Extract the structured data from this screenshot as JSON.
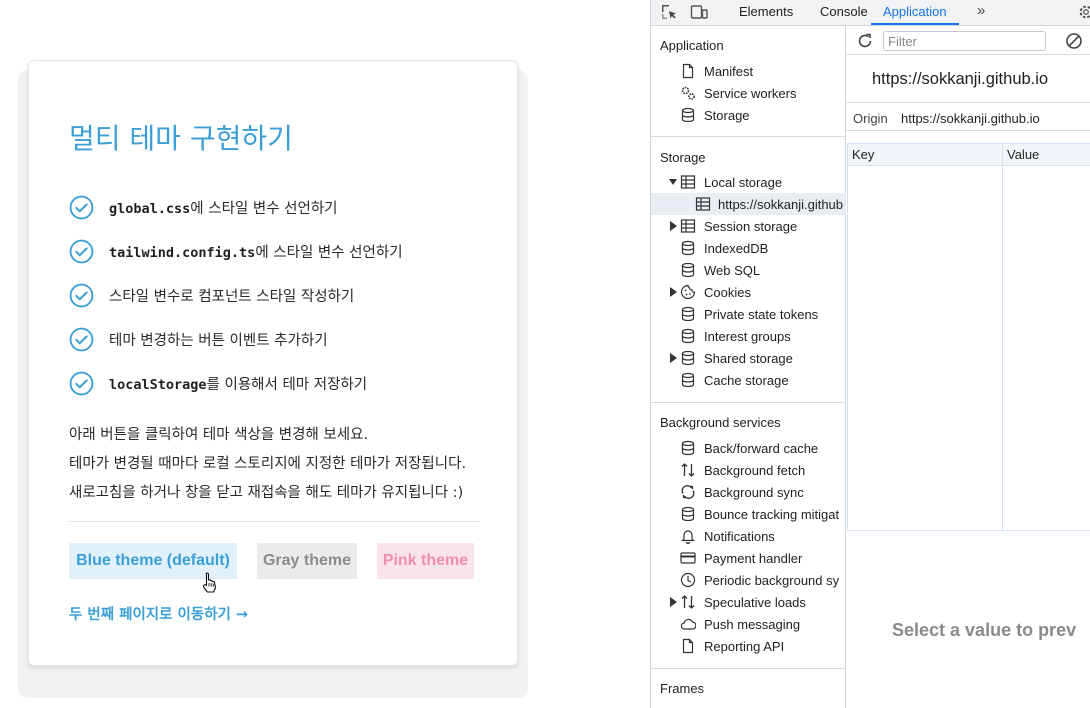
{
  "page": {
    "title": "멀티 테마 구현하기",
    "todos": [
      {
        "code": "global.css",
        "text": "에 스타일 변수 선언하기"
      },
      {
        "code": "tailwind.config.ts",
        "text": "에 스타일 변수 선언하기"
      },
      {
        "code": "",
        "text": "스타일 변수로 컴포넌트 스타일 작성하기"
      },
      {
        "code": "",
        "text": "테마 변경하는 버튼 이벤트 추가하기"
      },
      {
        "code": "localStorage",
        "text": "를 이용해서 테마 저장하기"
      }
    ],
    "description": [
      "아래 버튼을 클릭하여 테마 색상을 변경해 보세요.",
      "테마가 변경될 때마다 로컬 스토리지에 지정한 테마가 저장됩니다.",
      "새로고침을 하거나 창을 닫고 재접속을 해도 테마가 유지됩니다 :)"
    ],
    "buttons": {
      "blue": "Blue theme (default)",
      "gray": "Gray theme",
      "pink": "Pink theme"
    },
    "next_link": "두 번째 페이지로 이동하기 →",
    "colors": {
      "accent": "#3b9fd6",
      "gray": "#8c8c8c",
      "pink": "#ef8db2"
    }
  },
  "devtools": {
    "tabs": [
      "Elements",
      "Console",
      "Application"
    ],
    "active_tab": "Application",
    "more": "»",
    "sidebar": {
      "application_header": "Application",
      "application_items": [
        "Manifest",
        "Service workers",
        "Storage"
      ],
      "storage_header": "Storage",
      "storage_items": [
        "Local storage",
        "https://sokkanji.github",
        "Session storage",
        "IndexedDB",
        "Web SQL",
        "Cookies",
        "Private state tokens",
        "Interest groups",
        "Shared storage",
        "Cache storage"
      ],
      "background_header": "Background services",
      "background_items": [
        "Back/forward cache",
        "Background fetch",
        "Background sync",
        "Bounce tracking mitigat",
        "Notifications",
        "Payment handler",
        "Periodic background sy",
        "Speculative loads",
        "Push messaging",
        "Reporting API"
      ],
      "frames_header": "Frames"
    },
    "main": {
      "filter_placeholder": "Filter",
      "origin_title": "https://sokkanji.github.io",
      "origin_label": "Origin",
      "origin_value": "https://sokkanji.github.io",
      "columns": {
        "key": "Key",
        "value": "Value"
      },
      "empty_message": "Select a value to prev"
    }
  }
}
